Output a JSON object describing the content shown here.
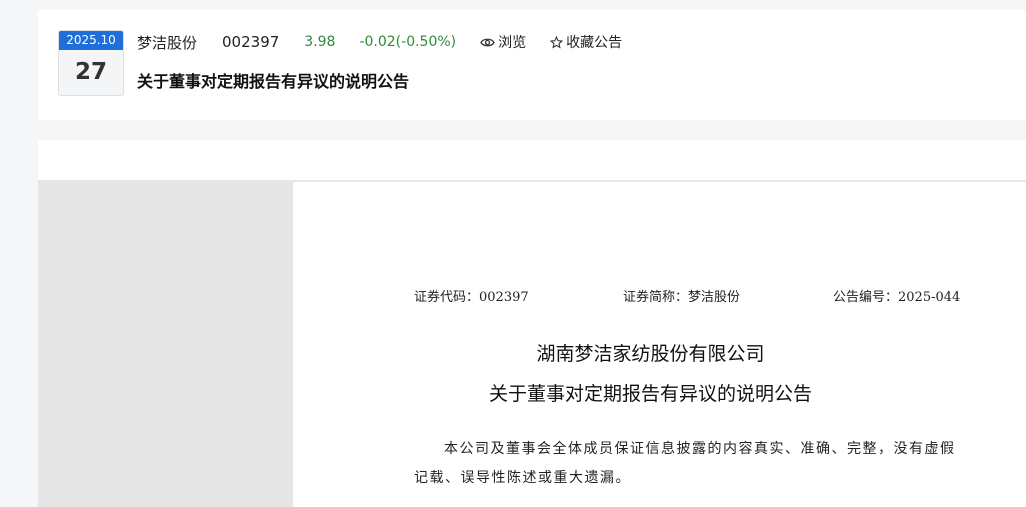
{
  "notice": {
    "date_month": "2025.10",
    "date_day": "27",
    "stock_name": "梦洁股份",
    "stock_code": "002397",
    "price": "3.98",
    "change": "-0.02(-0.50%)",
    "view_label": "浏览",
    "favorite_label": "收藏公告",
    "title": "关于董事对定期报告有异议的说明公告",
    "icons": {
      "view": "eye-icon",
      "favorite": "star-outline-icon"
    },
    "colors": {
      "accent": "#1e6fd9",
      "change": "#2e8b3a"
    }
  },
  "document": {
    "security_code": "证券代码：002397",
    "security_abbr": "证券简称：梦洁股份",
    "announcement_no": "公告编号：2025-044",
    "company": "湖南梦洁家纺股份有限公司",
    "title": "关于董事对定期报告有异议的说明公告",
    "body_line1": "本公司及董事会全体成员保证信息披露的内容真实、准确、完整，没有虚假",
    "body_line2": "记载、误导性陈述或重大遗漏。"
  }
}
